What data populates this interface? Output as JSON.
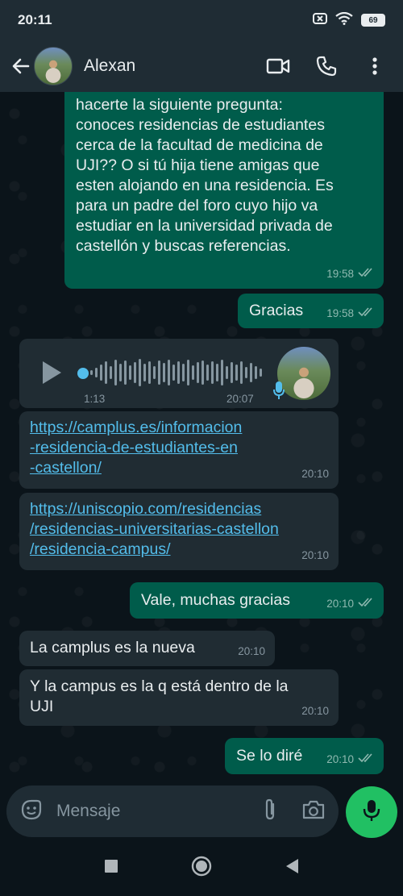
{
  "status": {
    "time": "20:11",
    "battery": "69"
  },
  "header": {
    "contact_name": "Alexan"
  },
  "messages": [
    {
      "text": "hacerte la siguiente pregunta:\nconoces residencias de estudiantes\ncerca de la facultad de medicina de\nUJI?? O si tú hija tiene amigas que\nesten alojando en una residencia. Es\npara un padre del foro cuyo hijo va\nestudiar en la universidad privada de\ncastellón y buscas referencias.",
      "time": "19:58"
    },
    {
      "text": "Gracias",
      "time": "19:58"
    },
    {
      "voice_duration": "1:13",
      "time": "20:07",
      "played_fraction": 0.0
    },
    {
      "link": "https://camplus.es/informacion\n-residencia-de-estudiantes-en\n-castellon/",
      "time": "20:10"
    },
    {
      "link": "https://uniscopio.com/residencias\n/residencias-universitarias-castellon\n/residencia-campus/",
      "time": "20:10"
    },
    {
      "text": "Vale, muchas gracias",
      "time": "20:10"
    },
    {
      "text": "La camplus es la nueva",
      "time": "20:10"
    },
    {
      "text": "Y la campus es la q está dentro de la\nUJI",
      "time": "20:10"
    },
    {
      "text": "Se lo diré",
      "time": "20:10"
    }
  ],
  "input": {
    "placeholder": "Mensaje"
  },
  "icons": {
    "back": "arrow-left",
    "video": "video-camera",
    "call": "phone",
    "menu": "more-vertical",
    "emoji": "sticker-smile",
    "attach": "paperclip",
    "camera": "camera",
    "mic": "microphone",
    "read": "double-check"
  },
  "colors": {
    "outgoing_bubble": "#005c4b",
    "incoming_bubble": "#202c33",
    "link": "#53bdeb",
    "accent": "#21c063",
    "header": "#1f2c34"
  }
}
